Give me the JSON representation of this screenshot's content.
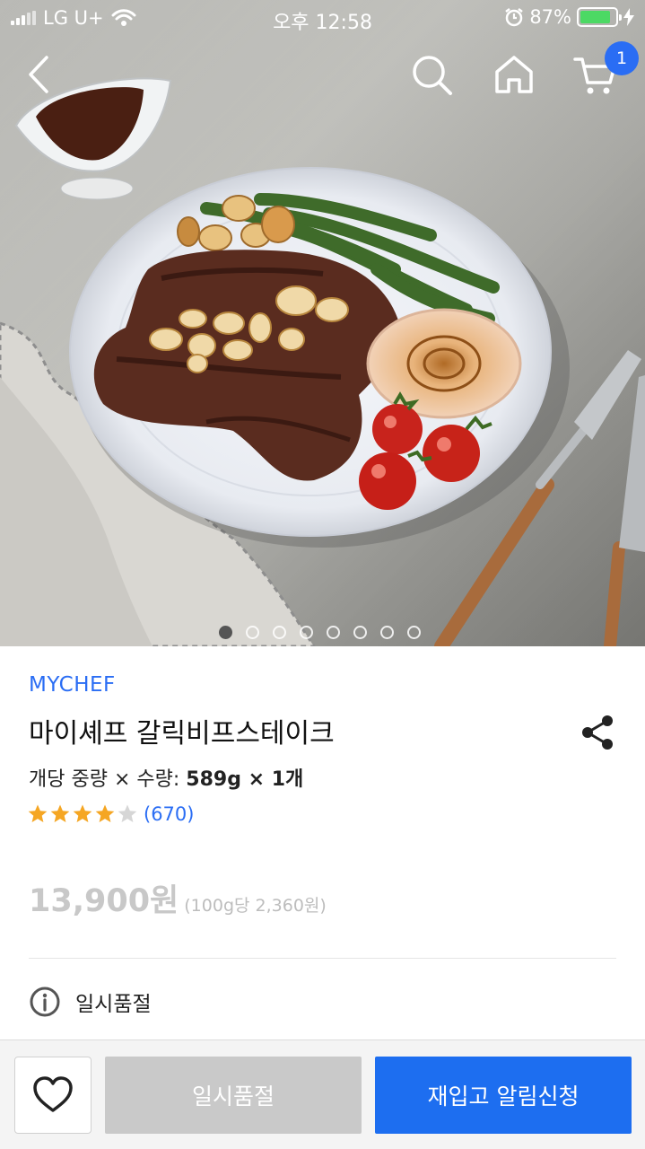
{
  "status_bar": {
    "carrier": "LG U+",
    "time": "오후 12:58",
    "battery_percent": "87%",
    "battery_level": 0.87,
    "colors": {
      "battery": "#4cd964"
    }
  },
  "top_nav": {
    "back_icon": "chevron-left-icon",
    "search_icon": "search-icon",
    "home_icon": "home-icon",
    "cart_icon": "cart-icon",
    "cart_count": "1"
  },
  "hero": {
    "image_subject": "garlic beef steak plate",
    "pager_total": 8,
    "pager_active": 1
  },
  "product": {
    "brand": "MYCHEF",
    "title": "마이셰프 갈릭비프스테이크",
    "weight_label": "개당 중량 × 수량: ",
    "weight_value": "589g × 1개",
    "rating": 4,
    "rating_max": 5,
    "review_count": "(670)",
    "price": "13,900원",
    "unit_price": "(100g당 2,360원)",
    "soldout_notice": "일시품절",
    "share_icon": "share-icon",
    "info_icon": "info-icon"
  },
  "bottom_bar": {
    "wish_icon": "heart-icon",
    "soldout_button": "일시품절",
    "restock_button": "재입고 알림신청"
  },
  "colors": {
    "accent": "#2a6df4",
    "restock_button": "#1d6ef0",
    "soldout_button": "#c9c9c9",
    "star": "#f5a623"
  }
}
